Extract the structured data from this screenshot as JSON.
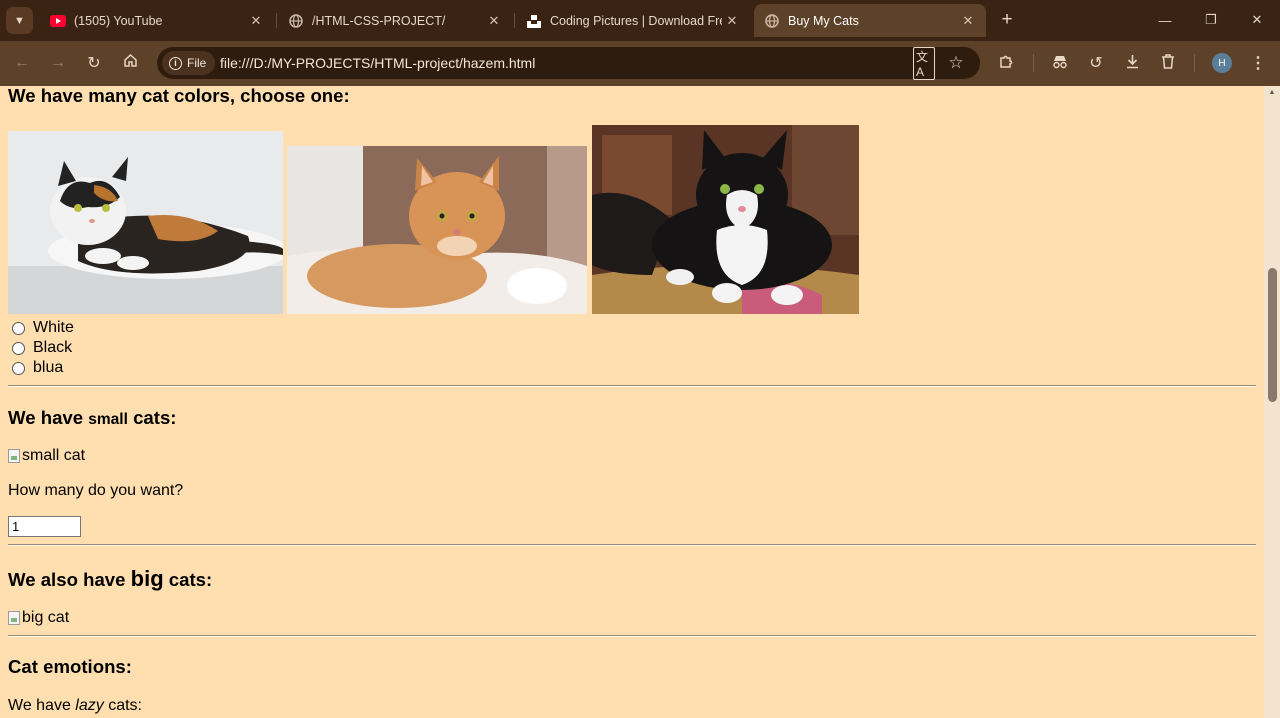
{
  "browser": {
    "tabs": [
      {
        "title": "(1505) YouTube",
        "favicon": "youtube-icon",
        "active": false
      },
      {
        "title": "/HTML-CSS-PROJECT/",
        "favicon": "globe-icon",
        "active": false
      },
      {
        "title": "Coding Pictures | Download Fre",
        "favicon": "unsplash-icon",
        "active": false
      },
      {
        "title": "Buy My Cats",
        "favicon": "globe-icon",
        "active": true
      }
    ],
    "url_scheme_label": "File",
    "url": "file:///D:/MY-PROJECTS/HTML-project/hazem.html",
    "profile_initial": "H",
    "accent": "#5e4129"
  },
  "page": {
    "background": "#ffdfaf",
    "colors_heading": "We have many cat colors, choose one:",
    "color_options": [
      "White",
      "Black",
      "blua"
    ],
    "small_heading": {
      "before": "We have ",
      "emph": "small",
      "after": " cats:"
    },
    "small_image_alt": "small cat",
    "quantity_question": "How many do you want?",
    "quantity_value": "1",
    "big_heading": {
      "before": "We also have ",
      "emph": "big",
      "after": " cats:"
    },
    "big_image_alt": "big cat",
    "emotions_heading": "Cat emotions:",
    "lazy_line": {
      "before": "We have ",
      "emph": "lazy",
      "after": " cats:"
    }
  }
}
